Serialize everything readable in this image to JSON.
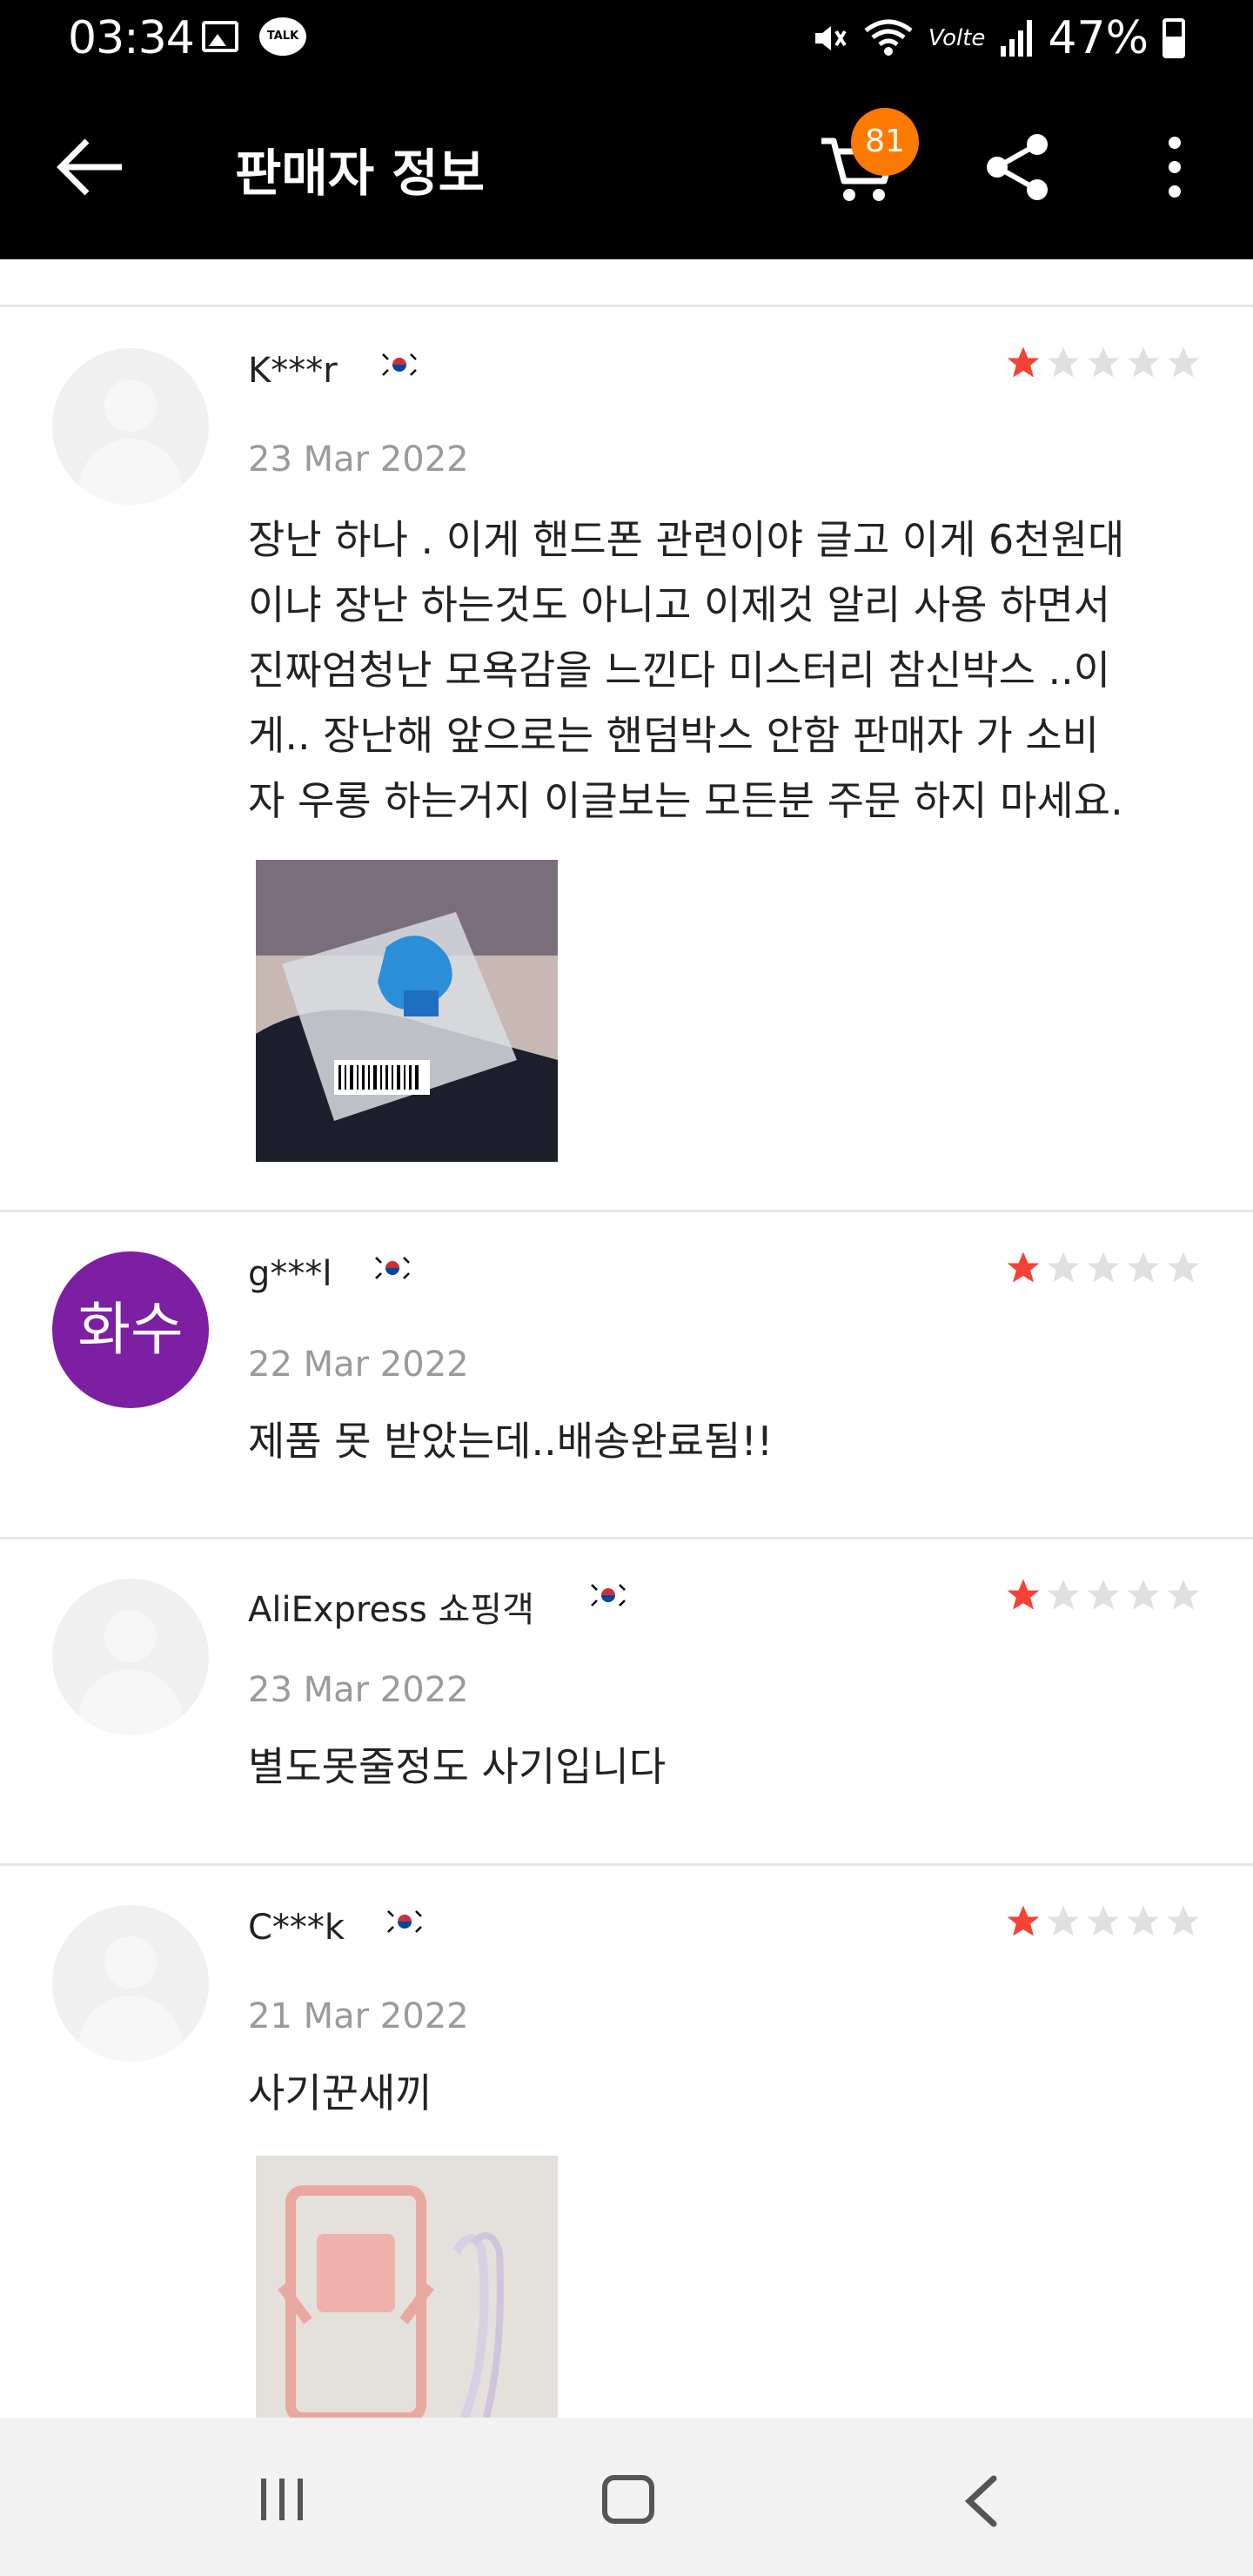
{
  "status_bar": {
    "time": "03:34",
    "talk_label": "TALK",
    "volte": "Volte",
    "battery": "47%",
    "icons": [
      "gallery-icon",
      "talk-icon",
      "mute-icon",
      "wifi-icon",
      "signal-icon",
      "battery-icon"
    ]
  },
  "header": {
    "title": "판매자 정보",
    "cart_count": "81",
    "icons": [
      "back-arrow-icon",
      "cart-icon",
      "share-icon",
      "more-vertical-icon"
    ]
  },
  "colors": {
    "header_bg": "#000000",
    "badge": "#ff7a00",
    "star_filled": "#f44336",
    "star_empty": "#e0e0e0",
    "avatar_purple": "#7c1fa3"
  },
  "reviews": [
    {
      "user": "K***r",
      "country": "KR",
      "rating": 1,
      "date": "23 Mar 2022",
      "lines": [
        "장난 하나 . 이게 핸드폰 관련이야 글고 이게 6천원대",
        "이냐 장난 하는것도 아니고 이제것 알리 사용 하면서",
        "진짜엄청난 모욕감을 느낀다 미스터리 참신박스 ..이",
        "게.. 장난해 앞으로는 핸덤박스 안함 판매자 가 소비",
        "자 우롱 하는거지 이글보는 모든분 주문 하지 마세요."
      ],
      "has_photo": true
    },
    {
      "user": "g***l",
      "avatar_text": "화수",
      "country": "KR",
      "rating": 1,
      "date": "22 Mar 2022",
      "lines": [
        "제품 못 받았는데..배송완료됨!!"
      ],
      "has_photo": false
    },
    {
      "user": "AliExpress 쇼핑객",
      "country": "KR",
      "rating": 1,
      "date": "23 Mar 2022",
      "lines": [
        "별도못줄정도 사기입니다"
      ],
      "has_photo": false
    },
    {
      "user": "C***k",
      "country": "KR",
      "rating": 1,
      "date": "21 Mar 2022",
      "lines": [
        "사기꾼새끼"
      ],
      "has_photo": true
    }
  ],
  "nav_bar": {
    "icons": [
      "recent-apps-icon",
      "home-icon",
      "back-icon"
    ]
  }
}
